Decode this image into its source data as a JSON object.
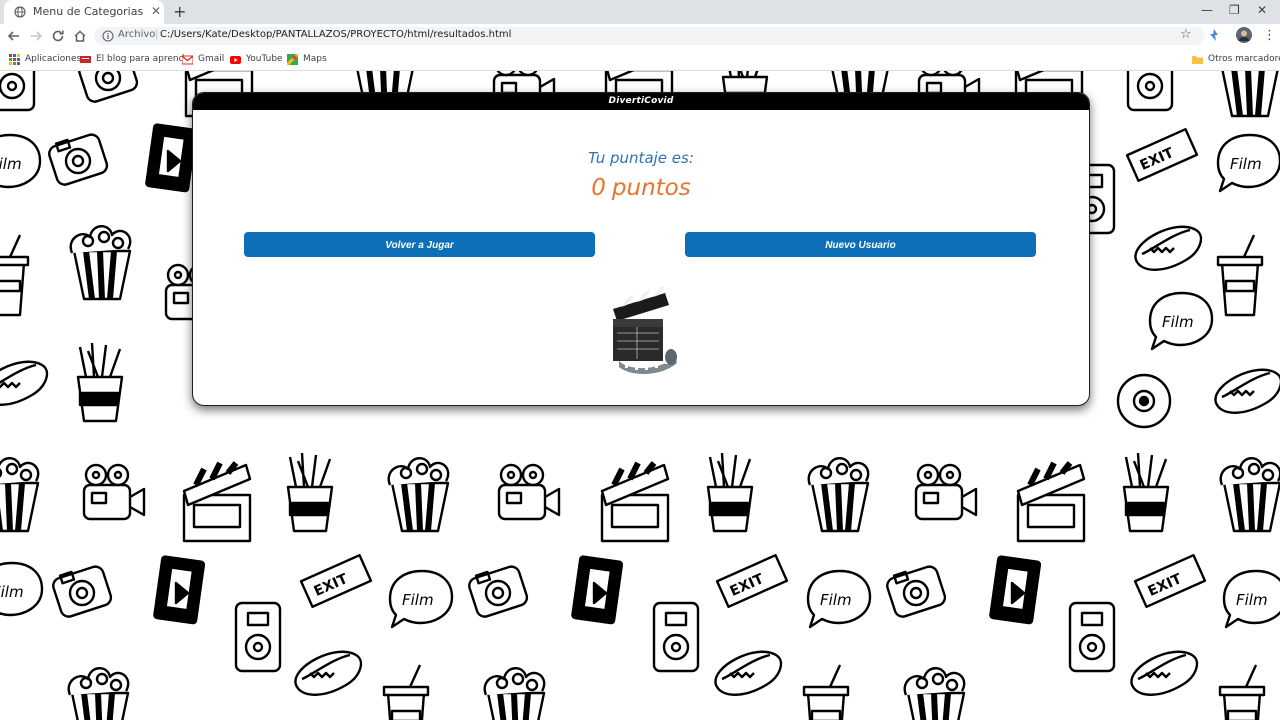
{
  "browser": {
    "tab_title": "Menu de Categorias",
    "tab_close": "✕",
    "new_tab": "+",
    "window_controls": [
      "—",
      "❐",
      "✕"
    ],
    "address_scheme": "Archivo",
    "address_url": "C:/Users/Kate/Desktop/PANTALLAZOS/PROYECTO/html/resultados.html",
    "star_icon": "☆",
    "menu_icon": "⋮",
    "bookmarks": [
      {
        "label": "Aplicaciones",
        "icon": "apps-grid-icon"
      },
      {
        "label": "El blog para aprend...",
        "icon": "blog-icon"
      },
      {
        "label": "Gmail",
        "icon": "gmail-icon"
      },
      {
        "label": "YouTube",
        "icon": "youtube-icon"
      },
      {
        "label": "Maps",
        "icon": "maps-icon"
      }
    ],
    "other_bookmarks": "Otros marcadores"
  },
  "card": {
    "header_title": "DivertiCovid",
    "score_label": "Tu puntaje es:",
    "score_value": "0",
    "score_unit": "puntos",
    "button_replay": "Volver a Jugar",
    "button_new_user": "Nuevo Usuario"
  },
  "colors": {
    "accent_blue": "#0c6fb8",
    "score_label": "#2a74b5",
    "score_value": "#e8742d",
    "header_bg": "#000000"
  }
}
